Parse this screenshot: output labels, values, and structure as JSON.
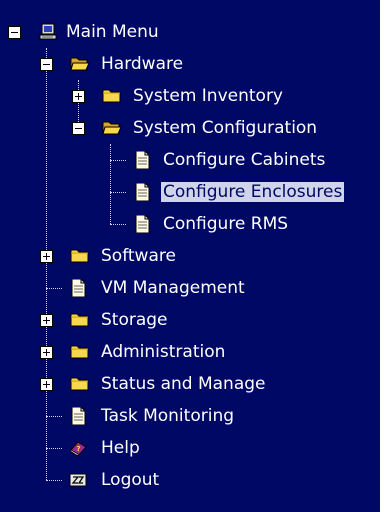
{
  "menu": {
    "root": "Main Menu",
    "hardware": "Hardware",
    "system_inventory": "System Inventory",
    "system_configuration": "System Configuration",
    "configure_cabinets": "Configure Cabinets",
    "configure_enclosures": "Configure Enclosures",
    "configure_rms": "Configure RMS",
    "software": "Software",
    "vm_management": "VM Management",
    "storage": "Storage",
    "administration": "Administration",
    "status_and_manage": "Status and Manage",
    "task_monitoring": "Task Monitoring",
    "help": "Help",
    "logout": "Logout"
  },
  "selected_item": "Configure Enclosures",
  "colors": {
    "background": "#000866",
    "text": "#ffffff",
    "selection": "#cfd4ea",
    "folder": "#f7d84a"
  },
  "icons": {
    "root": "computer-icon",
    "folder": "folder-icon",
    "document": "document-icon",
    "help": "help-book-icon",
    "logout": "sleep-zz-icon",
    "expand": "plus-box-icon",
    "collapse": "minus-box-icon"
  }
}
